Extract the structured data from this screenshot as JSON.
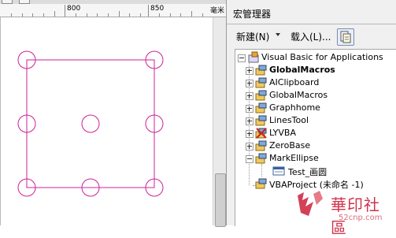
{
  "ruler": {
    "labels": [
      "800",
      "850"
    ],
    "unit": "毫米"
  },
  "docker": {
    "title": "宏管理器",
    "new_label": "新建(N)",
    "load_label": "载入(L)...",
    "tree": {
      "root": "Visual Basic for Applications",
      "projects": [
        "GlobalMacros",
        "AIClipboard",
        "GlobalMacros",
        "Graphhome",
        "LinesTool",
        "LYVBA",
        "ZeroBase",
        "MarkEllipse"
      ],
      "macro": "Test_画圆",
      "vba_project": "VBAProject (未命名 -1)"
    }
  },
  "watermark": {
    "brand": "華印社區",
    "url": "52cnp.com"
  },
  "colors": {
    "shape_stroke": "#cc2299",
    "watermark_red": "#c8102e"
  }
}
